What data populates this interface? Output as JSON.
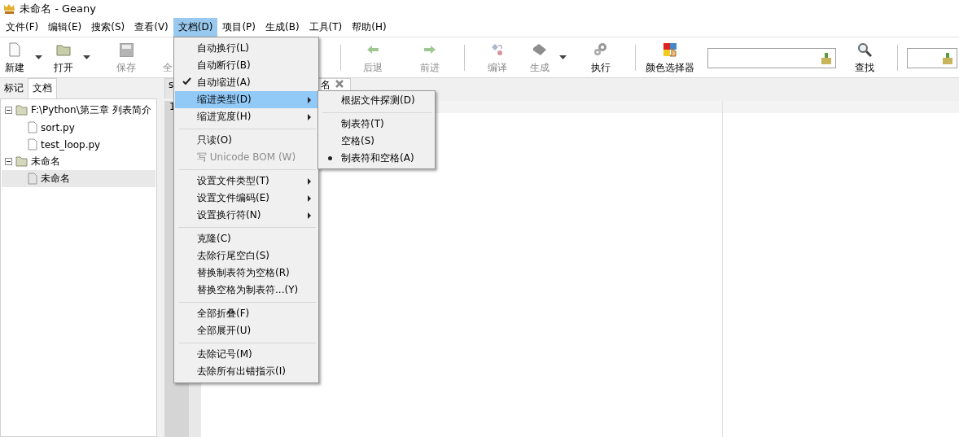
{
  "window": {
    "title": "未命名 - Geany"
  },
  "menubar": [
    {
      "label": "文件(F)",
      "selected": false
    },
    {
      "label": "编辑(E)",
      "selected": false
    },
    {
      "label": "搜索(S)",
      "selected": false
    },
    {
      "label": "查看(V)",
      "selected": false
    },
    {
      "label": "文档(D)",
      "selected": true
    },
    {
      "label": "项目(P)",
      "selected": false
    },
    {
      "label": "生成(B)",
      "selected": false
    },
    {
      "label": "工具(T)",
      "selected": false
    },
    {
      "label": "帮助(H)",
      "selected": false
    }
  ],
  "toolbar": [
    {
      "kind": "button",
      "label": "新建",
      "disabled": false
    },
    {
      "kind": "arrow"
    },
    {
      "kind": "button",
      "label": "打开",
      "disabled": false
    },
    {
      "kind": "arrow"
    },
    {
      "kind": "button",
      "label": "保存",
      "disabled": true
    },
    {
      "kind": "button",
      "label": "全",
      "disabled": true
    },
    {
      "kind": "separator"
    },
    {
      "kind": "button",
      "label": "后退",
      "disabled": true
    },
    {
      "kind": "button",
      "label": "前进",
      "disabled": true
    },
    {
      "kind": "separator"
    },
    {
      "kind": "button",
      "label": "编译",
      "disabled": true
    },
    {
      "kind": "button",
      "label": "生成",
      "disabled": true
    },
    {
      "kind": "arrow"
    },
    {
      "kind": "button",
      "label": "执行",
      "disabled": false
    },
    {
      "kind": "separator"
    },
    {
      "kind": "button",
      "label": "颜色选择器",
      "disabled": false
    },
    {
      "kind": "field"
    },
    {
      "kind": "button",
      "label": "查找",
      "disabled": false
    },
    {
      "kind": "separator"
    },
    {
      "kind": "field"
    }
  ],
  "sidebar": {
    "tabs": [
      {
        "label": "标记",
        "selected": false
      },
      {
        "label": "文档",
        "selected": true
      }
    ],
    "tree": [
      {
        "kind": "folder",
        "label": "F:\\Python\\第三章 列表简介",
        "expanded": true,
        "selected": false,
        "children": [
          {
            "kind": "file",
            "label": "sort.py",
            "selected": false
          },
          {
            "kind": "file",
            "label": "test_loop.py",
            "selected": false
          }
        ]
      },
      {
        "kind": "folder",
        "label": "未命名",
        "expanded": true,
        "selected": false,
        "children": [
          {
            "kind": "file",
            "label": "未命名",
            "selected": true
          }
        ]
      }
    ]
  },
  "editor": {
    "tabs": [
      {
        "label": "s",
        "selected": false
      },
      {
        "label": "名",
        "selected": true,
        "close_button": true
      }
    ],
    "line_numbers": [
      "1"
    ]
  },
  "menu": {
    "items": [
      {
        "kind": "item",
        "label": "自动换行(L)",
        "checked": false,
        "disabled": false,
        "submenu": false,
        "selected": false
      },
      {
        "kind": "item",
        "label": "自动断行(B)",
        "checked": false,
        "disabled": false,
        "submenu": false,
        "selected": false
      },
      {
        "kind": "item",
        "label": "自动缩进(A)",
        "checked": true,
        "disabled": false,
        "submenu": false,
        "selected": false
      },
      {
        "kind": "item",
        "label": "缩进类型(D)",
        "checked": false,
        "disabled": false,
        "submenu": true,
        "selected": true
      },
      {
        "kind": "item",
        "label": "缩进宽度(H)",
        "checked": false,
        "disabled": false,
        "submenu": true,
        "selected": false
      },
      {
        "kind": "separator"
      },
      {
        "kind": "item",
        "label": "只读(O)",
        "checked": false,
        "disabled": false,
        "submenu": false,
        "selected": false
      },
      {
        "kind": "item",
        "label": "写 Unicode BOM (W)",
        "checked": false,
        "disabled": true,
        "submenu": false,
        "selected": false
      },
      {
        "kind": "separator"
      },
      {
        "kind": "item",
        "label": "设置文件类型(T)",
        "checked": false,
        "disabled": false,
        "submenu": true,
        "selected": false
      },
      {
        "kind": "item",
        "label": "设置文件编码(E)",
        "checked": false,
        "disabled": false,
        "submenu": true,
        "selected": false
      },
      {
        "kind": "item",
        "label": "设置换行符(N)",
        "checked": false,
        "disabled": false,
        "submenu": true,
        "selected": false
      },
      {
        "kind": "separator"
      },
      {
        "kind": "item",
        "label": "克隆(C)",
        "checked": false,
        "disabled": false,
        "submenu": false,
        "selected": false
      },
      {
        "kind": "item",
        "label": "去除行尾空白(S)",
        "checked": false,
        "disabled": false,
        "submenu": false,
        "selected": false
      },
      {
        "kind": "item",
        "label": "替换制表符为空格(R)",
        "checked": false,
        "disabled": false,
        "submenu": false,
        "selected": false
      },
      {
        "kind": "item",
        "label": "替换空格为制表符...(Y)",
        "checked": false,
        "disabled": false,
        "submenu": false,
        "selected": false
      },
      {
        "kind": "separator"
      },
      {
        "kind": "item",
        "label": "全部折叠(F)",
        "checked": false,
        "disabled": false,
        "submenu": false,
        "selected": false
      },
      {
        "kind": "item",
        "label": "全部展开(U)",
        "checked": false,
        "disabled": false,
        "submenu": false,
        "selected": false
      },
      {
        "kind": "separator"
      },
      {
        "kind": "item",
        "label": "去除记号(M)",
        "checked": false,
        "disabled": false,
        "submenu": false,
        "selected": false
      },
      {
        "kind": "item",
        "label": "去除所有出错指示(I)",
        "checked": false,
        "disabled": false,
        "submenu": false,
        "selected": false
      }
    ]
  },
  "submenu": {
    "items": [
      {
        "kind": "item",
        "label": "根据文件探测(D)",
        "selected": false
      },
      {
        "kind": "separator"
      },
      {
        "kind": "item",
        "label": "制表符(T)",
        "selected": false
      },
      {
        "kind": "item",
        "label": "空格(S)",
        "selected": false
      },
      {
        "kind": "item",
        "label": "制表符和空格(A)",
        "selected": true
      }
    ]
  }
}
